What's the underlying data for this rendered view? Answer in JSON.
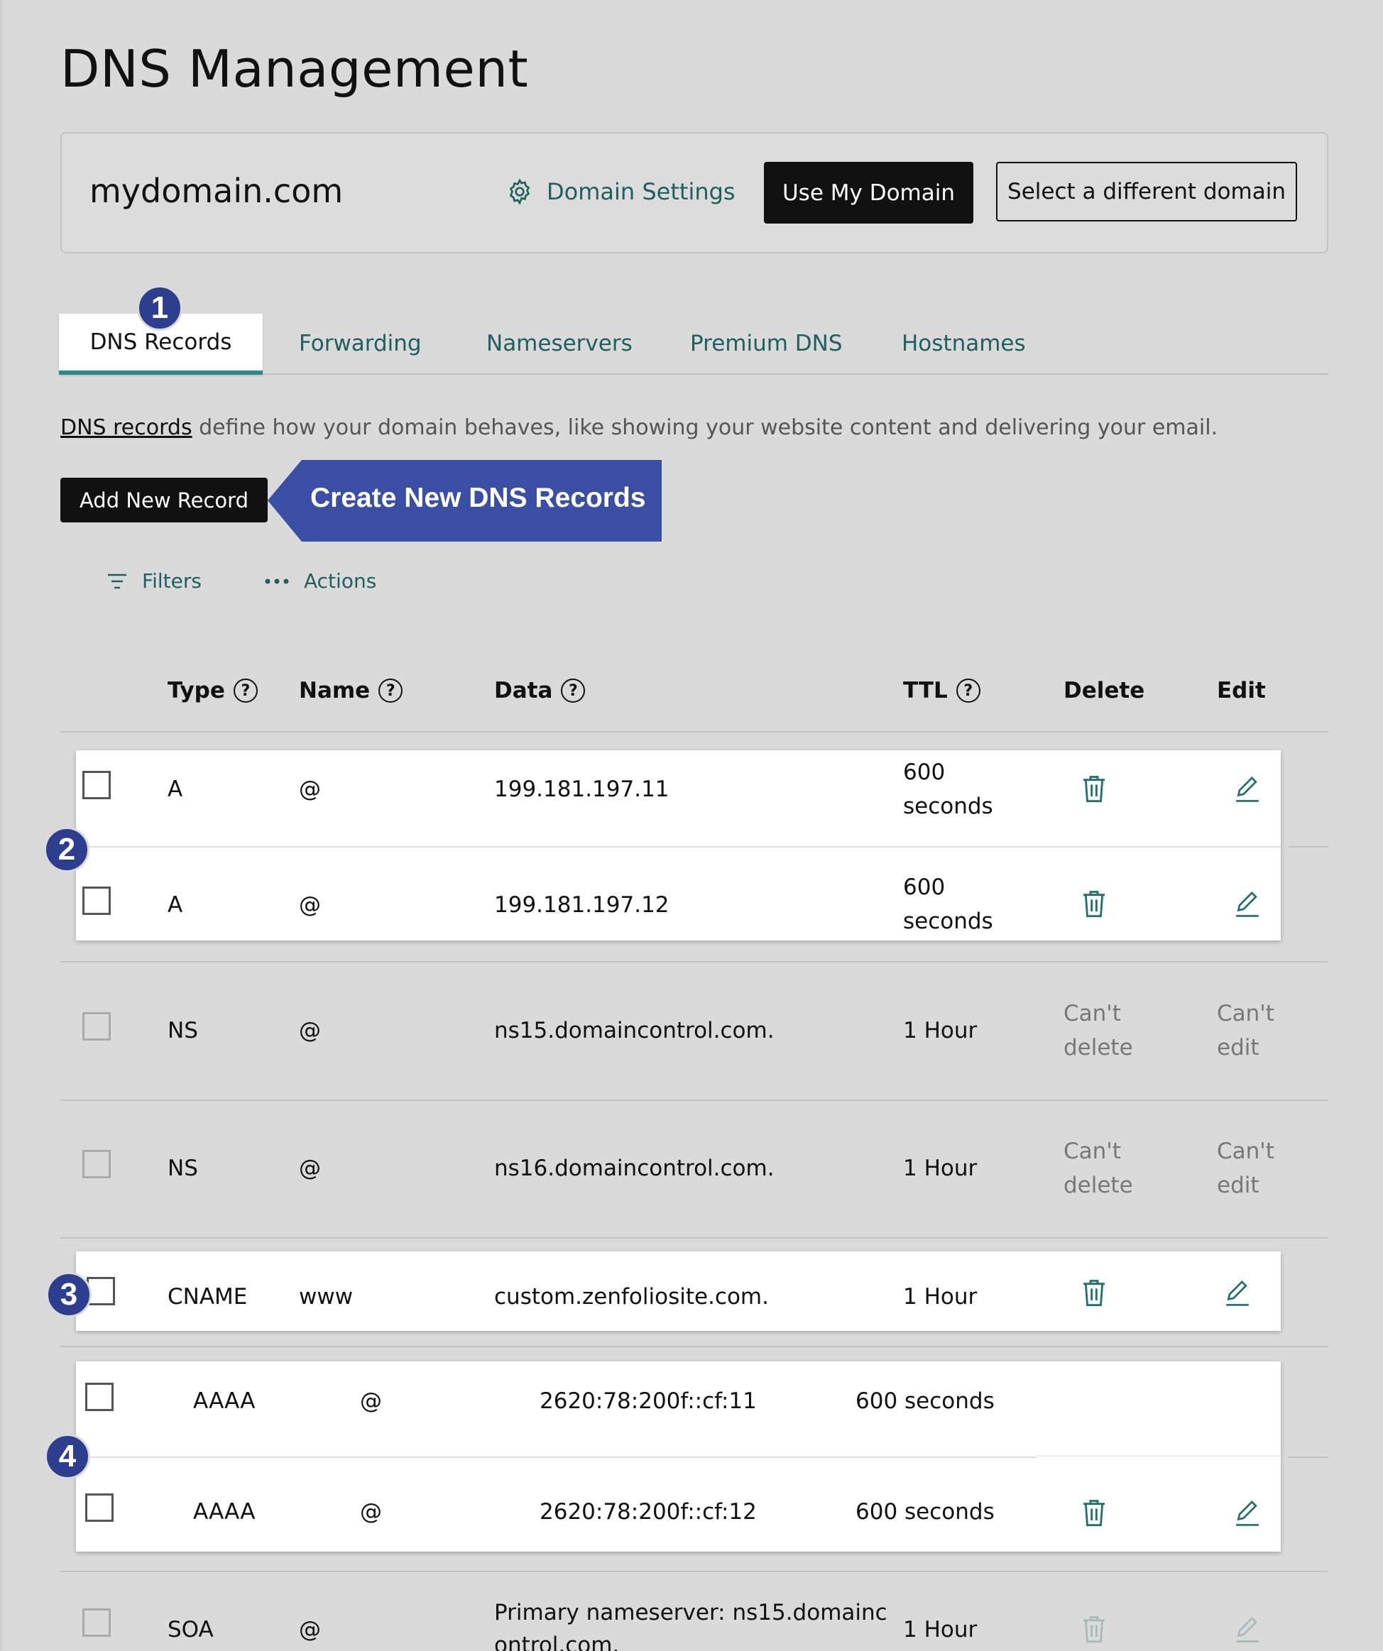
{
  "page": {
    "title": "DNS Management"
  },
  "domain": {
    "name": "mydomain.com",
    "settings_label": "Domain Settings",
    "use_button": "Use My Domain",
    "select_button": "Select a different domain"
  },
  "tabs": [
    {
      "label": "DNS Records",
      "active": true
    },
    {
      "label": "Forwarding"
    },
    {
      "label": "Nameservers"
    },
    {
      "label": "Premium DNS"
    },
    {
      "label": "Hostnames"
    }
  ],
  "badges": [
    "1",
    "2",
    "3",
    "4"
  ],
  "description": {
    "link": "DNS records",
    "text": " define how your domain behaves, like showing your website content and delivering your email."
  },
  "add_button": "Add New Record",
  "callout": "Create New DNS Records",
  "toolbar": {
    "filters": "Filters",
    "actions": "Actions"
  },
  "columns": {
    "type": "Type",
    "name": "Name",
    "data": "Data",
    "ttl": "TTL",
    "delete": "Delete",
    "edit": "Edit",
    "help": "?"
  },
  "records": [
    {
      "type": "A",
      "name": "@",
      "data": "199.181.197.11",
      "ttl_line1": "600",
      "ttl_line2": "seconds"
    },
    {
      "type": "A",
      "name": "@",
      "data": "199.181.197.12",
      "ttl_line1": "600",
      "ttl_line2": "seconds"
    },
    {
      "type": "NS",
      "name": "@",
      "data": "ns15.domaincontrol.com.",
      "ttl": "1 Hour",
      "delete_line1": "Can't",
      "delete_line2": "delete",
      "edit_line1": "Can't",
      "edit_line2": "edit"
    },
    {
      "type": "NS",
      "name": "@",
      "data": "ns16.domaincontrol.com.",
      "ttl": "1 Hour",
      "delete_line1": "Can't",
      "delete_line2": "delete",
      "edit_line1": "Can't",
      "edit_line2": "edit"
    },
    {
      "type": "CNAME",
      "name": "www",
      "data": "custom.zenfoliosite.com.",
      "ttl": "1 Hour"
    },
    {
      "type": "AAAA",
      "name": "@",
      "data": "2620:78:200f::cf:11",
      "ttl": "600 seconds"
    },
    {
      "type": "AAAA",
      "name": "@",
      "data": "2620:78:200f::cf:12",
      "ttl": "600 seconds"
    },
    {
      "type": "SOA",
      "name": "@",
      "data_line1": "Primary nameserver: ns15.domainc",
      "data_line2": "ontrol.com.",
      "ttl": "1 Hour"
    }
  ],
  "colors": {
    "accent_teal": "#1f5f5f",
    "tab_underline": "#2a8a8a",
    "badge_blue": "#2d3e8f",
    "callout_blue": "#3a4fa3"
  }
}
